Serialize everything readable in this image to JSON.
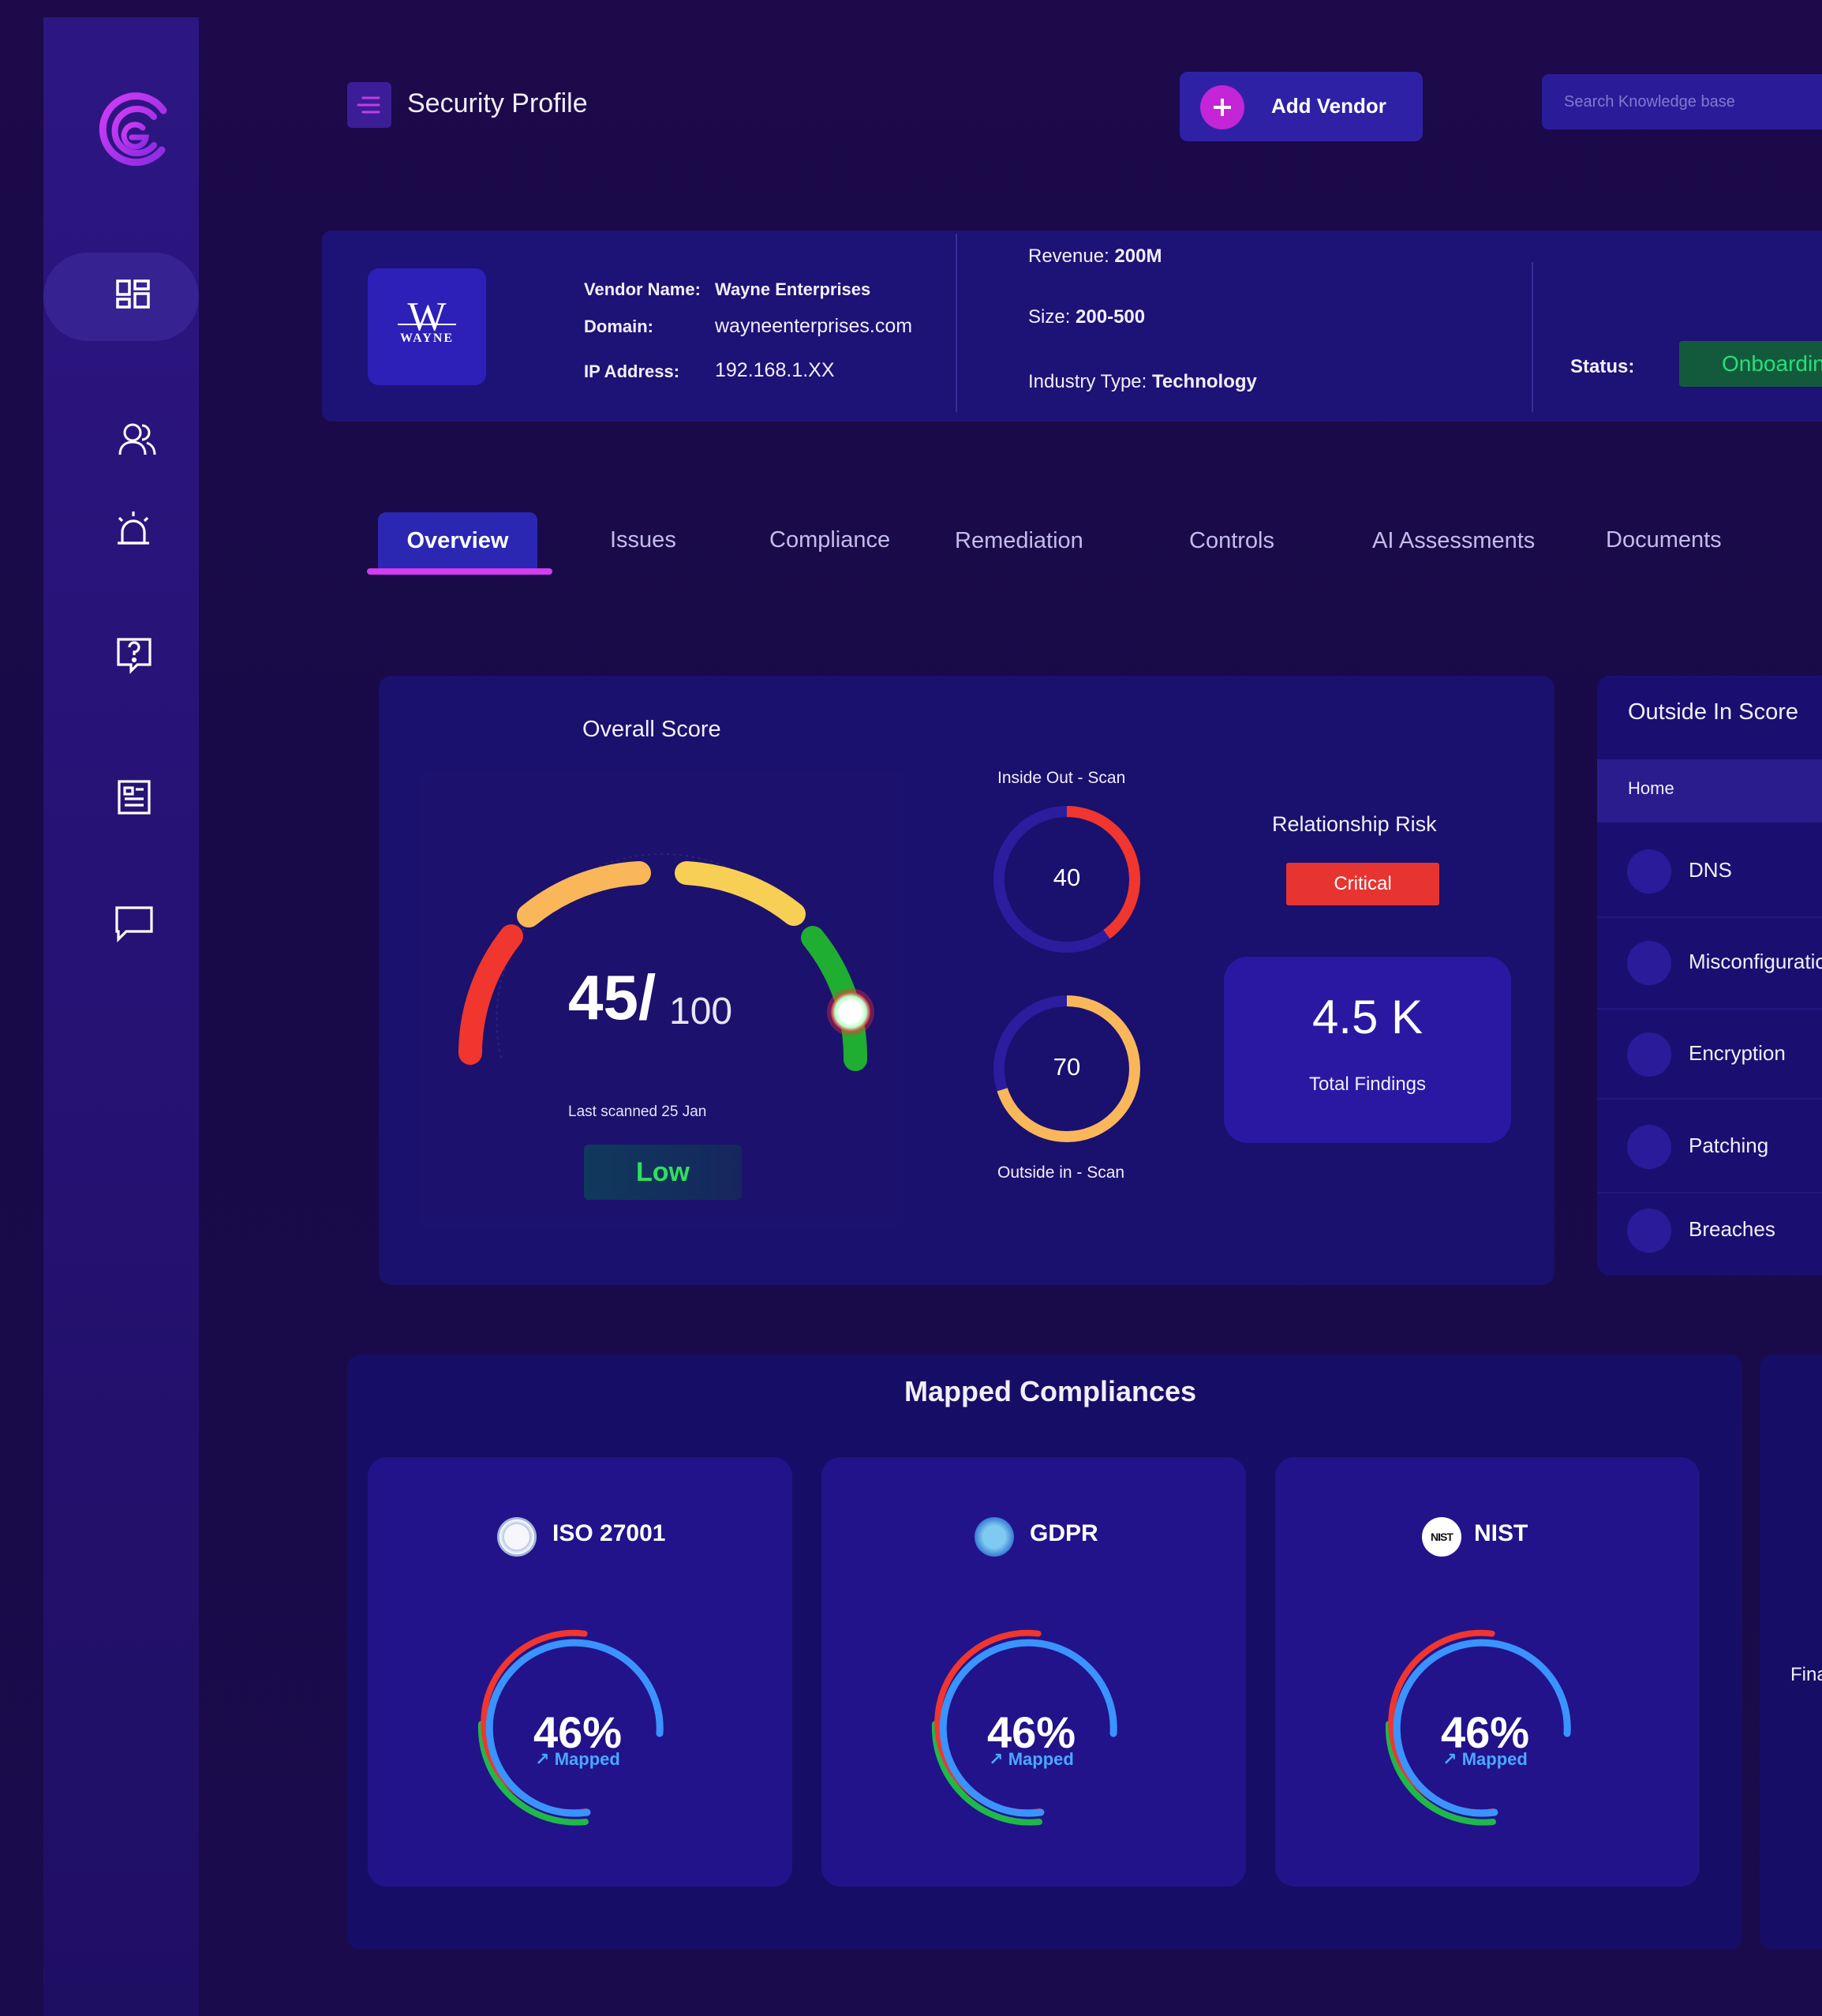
{
  "app": {
    "title": "Security Profile",
    "add_vendor_label": "Add Vendor",
    "search_placeholder": "Search Knowledge base"
  },
  "sidebar": {
    "items": [
      {
        "icon": "dashboard-icon",
        "active": true
      },
      {
        "icon": "users-icon"
      },
      {
        "icon": "alarm-icon"
      },
      {
        "icon": "help-icon"
      },
      {
        "icon": "document-icon"
      },
      {
        "icon": "chat-icon"
      }
    ]
  },
  "vendor": {
    "logo_text": "W",
    "logo_sub": "WAYNE",
    "name_label": "Vendor Name:",
    "name": "Wayne Enterprises",
    "domain_label": "Domain:",
    "domain": "wayneenterprises.com",
    "ip_label": "IP Address:",
    "ip": "192.168.1.XX",
    "revenue_label": "Revenue:",
    "revenue": "200M",
    "size_label": "Size:",
    "size": "200-500",
    "industry_label": "Industry Type:",
    "industry": "Technology",
    "status_label": "Status:",
    "status": "Onboarding"
  },
  "tabs": [
    "Overview",
    "Issues",
    "Compliance",
    "Remediation",
    "Controls",
    "AI Assessments",
    "Documents"
  ],
  "active_tab": "Overview",
  "overall": {
    "title": "Overall Score",
    "score": "45/",
    "max": "100",
    "score_value": 45,
    "last_scanned": "Last scanned 25 Jan",
    "level": "Low"
  },
  "scans": {
    "inside_label": "Inside Out - Scan",
    "inside_value": "40",
    "outside_label": "Outside in - Scan",
    "outside_value": "70",
    "inside_fraction": 0.4,
    "outside_fraction": 0.7
  },
  "relationship": {
    "title": "Relationship Risk",
    "level": "Critical",
    "findings_value": "4.5 K",
    "findings_label": "Total Findings"
  },
  "outside_in": {
    "title": "Outside In Score",
    "home": "Home",
    "items": [
      "DNS",
      "Misconfiguration",
      "Encryption",
      "Patching",
      "Breaches"
    ]
  },
  "compliances": {
    "title": "Mapped Compliances",
    "cards": [
      {
        "name": "ISO 27001",
        "percent": "46%",
        "mapped": "Mapped",
        "icon": "iso-badge-icon"
      },
      {
        "name": "GDPR",
        "percent": "46%",
        "mapped": "Mapped",
        "icon": "gdpr-badge-icon"
      },
      {
        "name": "NIST",
        "percent": "46%",
        "mapped": "Mapped",
        "icon": "nist-badge-icon",
        "icon_text": "NIST"
      }
    ],
    "side_label": "Fina"
  },
  "colors": {
    "accent": "#c425d6",
    "critical": "#e73431",
    "low": "#2fe05c",
    "status": "#25e07a"
  }
}
